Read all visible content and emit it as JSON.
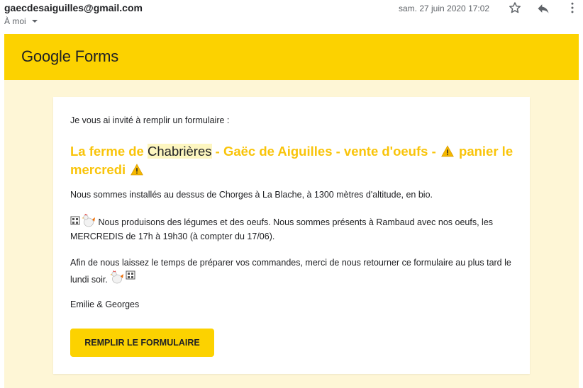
{
  "header": {
    "sender": "gaecdesaiguilles@gmail.com",
    "to": "À moi",
    "date": "sam. 27 juin 2020 17:02"
  },
  "banner": {
    "logo_google": "Google",
    "logo_forms": "Forms",
    "color": "#fcd200"
  },
  "content": {
    "intro": "Je vous ai invité à remplir un formulaire :",
    "title_before": "La ferme de ",
    "title_highlight": "Chabrières",
    "title_after": " - Gaëc de Aiguilles - vente d'oeufs - ",
    "title_mid": " panier le mercredi ",
    "p1": "Nous sommes installés au dessus de Chorges à La Blache, à 1300 mètres d'altitude, en bio.",
    "p2": "Nous produisons des légumes et des oeufs. Nous sommes présents à Rambaud avec nos oeufs, les MERCREDIS de 17h à 19h30 (à compter du 17/06).",
    "p3": "Afin de nous laissez le temps de préparer vos commandes, merci de nous retourner ce formulaire au plus tard le lundi soir.",
    "signature": "Emilie & Georges",
    "button_label": "REMPLIR LE FORMULAIRE"
  },
  "colors": {
    "title": "#f9c40a",
    "background": "#fef6d6",
    "accent": "#fcd200"
  },
  "icons": [
    "star-icon",
    "reply-icon",
    "more-vert-icon",
    "warning-icon",
    "rooster-icon",
    "dropdown-caret-icon"
  ]
}
